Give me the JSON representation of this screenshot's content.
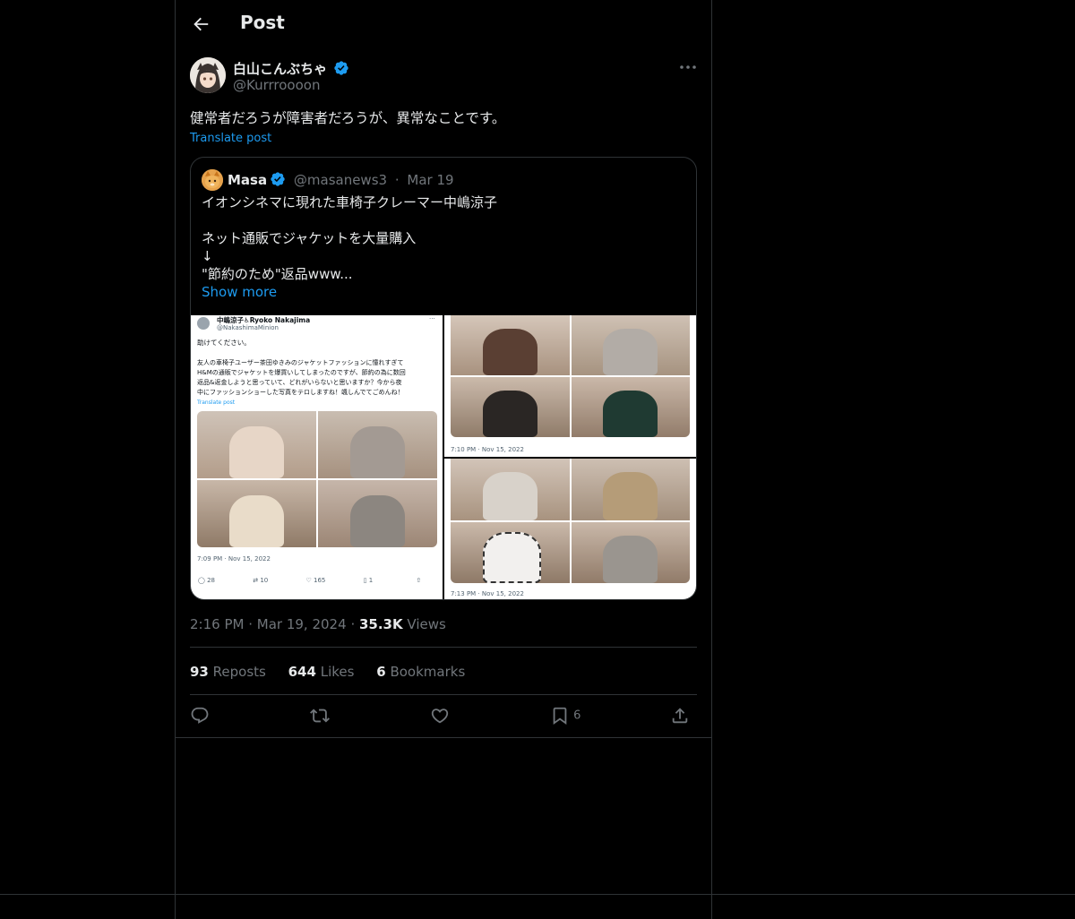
{
  "header": {
    "title": "Post"
  },
  "post": {
    "author_name": "白山こんぶちゃ",
    "author_handle": "@Kurrroooon",
    "text": "健常者だろうが障害者だろうが、異常なことです。",
    "translate_label": "Translate post",
    "time": "2:16 PM",
    "date": "Mar 19, 2024",
    "views_count": "35.3K",
    "views_label": "Views"
  },
  "quote": {
    "author_name": "Masa",
    "author_handle": "@masanews3",
    "date": "Mar 19",
    "text": "イオンシネマに現れた車椅子クレーマー中嶋涼子\n\nネット通販でジャケットを大量購入\n↓\n\"節約のため\"返品www...",
    "show_more": "Show more",
    "media": {
      "screenshot1": {
        "name": "中嶋涼子♿Ryoko Nakajima",
        "handle": "@NakashimaMinion",
        "line1": "助けてください。",
        "body": "友人の車椅子ユーザー茶田ゆきみのジャケットファッションに憧れすぎて\nH&Mの通販でジャケットを爆買いしてしまったのですが、節約の為に数回\n返品&返金しようと思っていて、どれがいらないと思いますか？今から夜\n中にファッションショーした写真をテロしますね！颯しんでてごめんね！",
        "translate": "Translate post",
        "timestamp": "7:09 PM · Nov 15, 2022",
        "replies": "28",
        "reposts": "10",
        "likes": "165",
        "bookmarks": "1"
      },
      "screenshot2": {
        "timestamp": "7:10 PM · Nov 15, 2022"
      },
      "screenshot3": {
        "timestamp": "7:13 PM · Nov 15, 2022"
      }
    }
  },
  "stats": {
    "reposts_count": "93",
    "reposts_label": "Reposts",
    "likes_count": "644",
    "likes_label": "Likes",
    "bookmarks_count": "6",
    "bookmarks_label": "Bookmarks"
  },
  "actions": {
    "bookmark_count": "6"
  },
  "colors": {
    "accent": "#1d9bf0",
    "background": "#000000",
    "muted": "#71767b",
    "border": "#2f3336"
  }
}
